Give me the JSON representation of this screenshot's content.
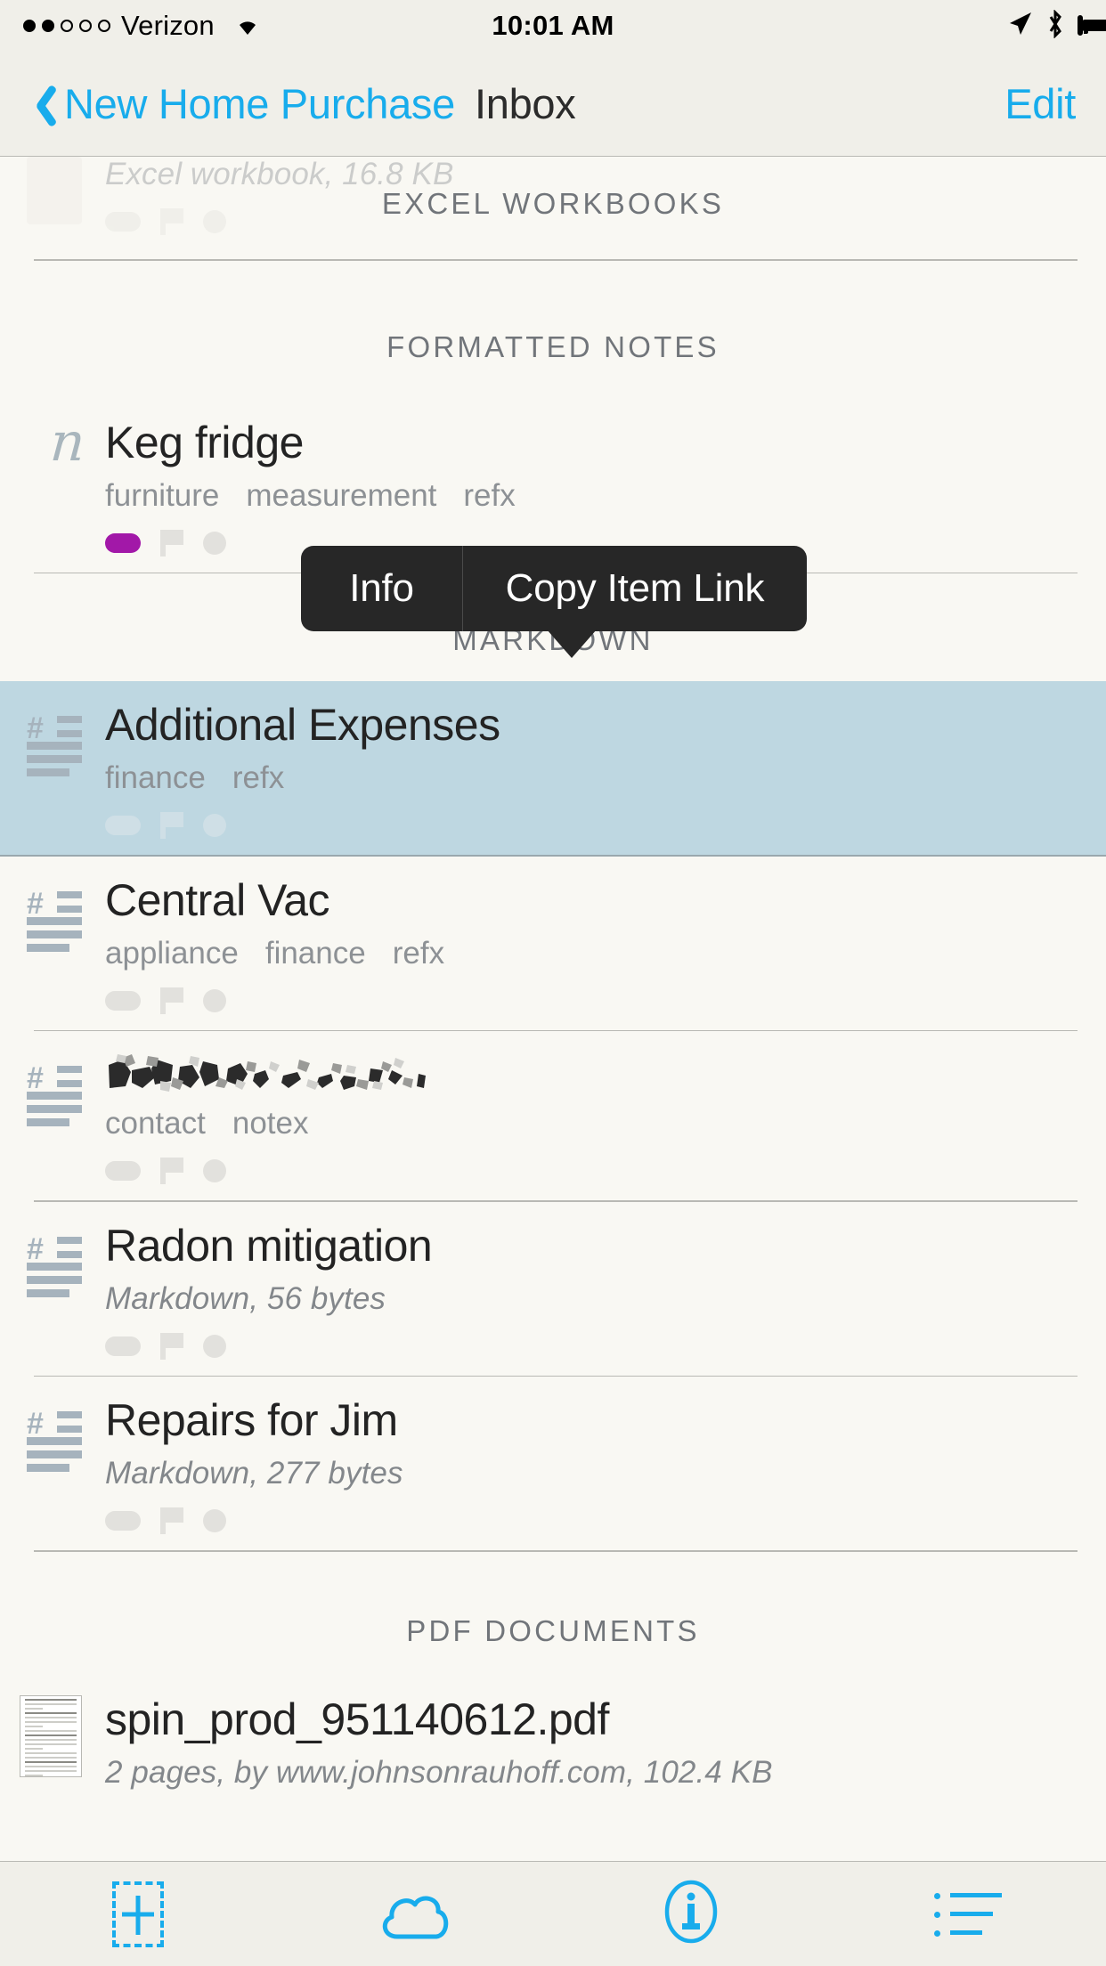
{
  "statusbar": {
    "carrier": "Verizon",
    "signal_dots_filled": 2,
    "signal_dots_total": 5,
    "wifi_icon": "wifi-icon",
    "time": "10:01 AM",
    "location_icon": "location-arrow-icon",
    "bluetooth_icon": "bluetooth-icon",
    "battery_icon": "battery-icon",
    "battery_level": 88
  },
  "navbar": {
    "back_label": "New Home Purchase",
    "back_icon": "chevron-left-icon",
    "title": "Inbox",
    "edit_label": "Edit"
  },
  "colors": {
    "accent": "#18acec",
    "background": "#f9f8f3",
    "chrome": "#f0efe9",
    "selection": "#bed7e1",
    "popover": "#272727",
    "label_purple": "#a218a8",
    "icon_gray": "#a6b3bd",
    "text_secondary": "#83878b"
  },
  "popover": {
    "items": [
      {
        "label": "Info"
      },
      {
        "label": "Copy Item Link"
      }
    ]
  },
  "sections": [
    {
      "id": "excel-workbooks",
      "header": "EXCEL WORKBOOKS",
      "partial_row_above": {
        "subtitle": "Excel workbook, 16.8 KB"
      }
    },
    {
      "id": "formatted-notes",
      "header": "FORMATTED NOTES",
      "rows": [
        {
          "icon": "cursive-n-icon",
          "icon_glyph": "n",
          "title": "Keg fridge",
          "tags": [
            "furniture",
            "measurement",
            "refx"
          ],
          "label_color": "#a218a8",
          "flagged": false,
          "unread": false
        }
      ]
    },
    {
      "id": "markdown",
      "header": "MARKDOWN",
      "rows": [
        {
          "icon": "markdown-icon",
          "title": "Additional Expenses",
          "tags": [
            "finance",
            "refx"
          ],
          "selected": true,
          "label_color": null,
          "flagged": false,
          "unread": false
        },
        {
          "icon": "markdown-icon",
          "title": "Central Vac",
          "tags": [
            "appliance",
            "finance",
            "refx"
          ],
          "selected": false,
          "label_color": null,
          "flagged": false,
          "unread": false
        },
        {
          "icon": "markdown-icon",
          "title": "",
          "title_redacted": true,
          "tags": [
            "contact",
            "notex"
          ],
          "selected": false,
          "label_color": null,
          "flagged": false,
          "unread": false
        },
        {
          "icon": "markdown-icon",
          "title": "Radon mitigation",
          "subtitle": "Markdown, 56 bytes",
          "selected": false,
          "label_color": null,
          "flagged": false,
          "unread": false
        },
        {
          "icon": "markdown-icon",
          "title": "Repairs for Jim",
          "subtitle": "Markdown, 277 bytes",
          "selected": false,
          "label_color": null,
          "flagged": false,
          "unread": false
        }
      ]
    },
    {
      "id": "pdf-documents",
      "header": "PDF DOCUMENTS",
      "rows": [
        {
          "icon": "pdf-thumbnail-icon",
          "title": "spin_prod_951140612.pdf",
          "subtitle": "2 pages, by www.johnsonrauhoff.com, 102.4 KB"
        }
      ]
    }
  ],
  "toolbar": {
    "buttons": [
      {
        "icon": "add-item-icon",
        "name": "add-button"
      },
      {
        "icon": "cloud-icon",
        "name": "sync-button"
      },
      {
        "icon": "info-circle-icon",
        "name": "info-button"
      },
      {
        "icon": "list-options-icon",
        "name": "list-options-button"
      }
    ]
  }
}
